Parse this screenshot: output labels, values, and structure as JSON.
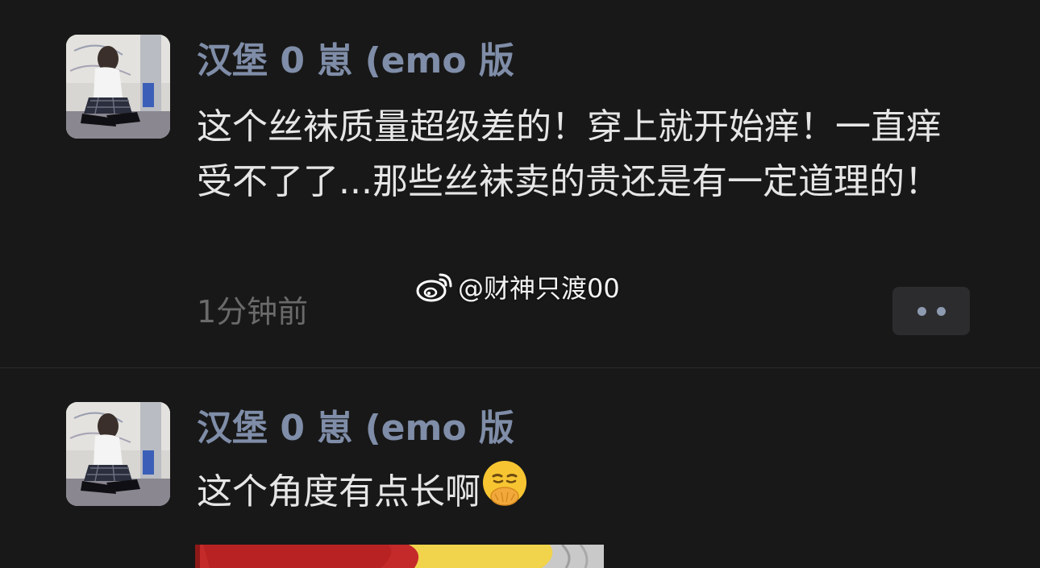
{
  "posts": [
    {
      "username": "汉堡 0 崽 (emo 版",
      "content": "这个丝袜质量超级差的！穿上就开始痒！一直痒受不了了...那些丝袜卖的贵还是有一定道理的！",
      "timestamp": "1分钟前"
    },
    {
      "username": "汉堡 0 崽 (emo 版",
      "content": "这个角度有点长啊",
      "emoji": "face-with-hand-over-mouth"
    }
  ],
  "watermark": {
    "text": "@财神只渡00",
    "icon": "weibo-icon"
  },
  "colors": {
    "background": "#181818",
    "username": "#7f8da8",
    "content": "#e6e6e6",
    "timestamp": "#6a6a6a",
    "more_button_bg": "#2c2c2e"
  }
}
